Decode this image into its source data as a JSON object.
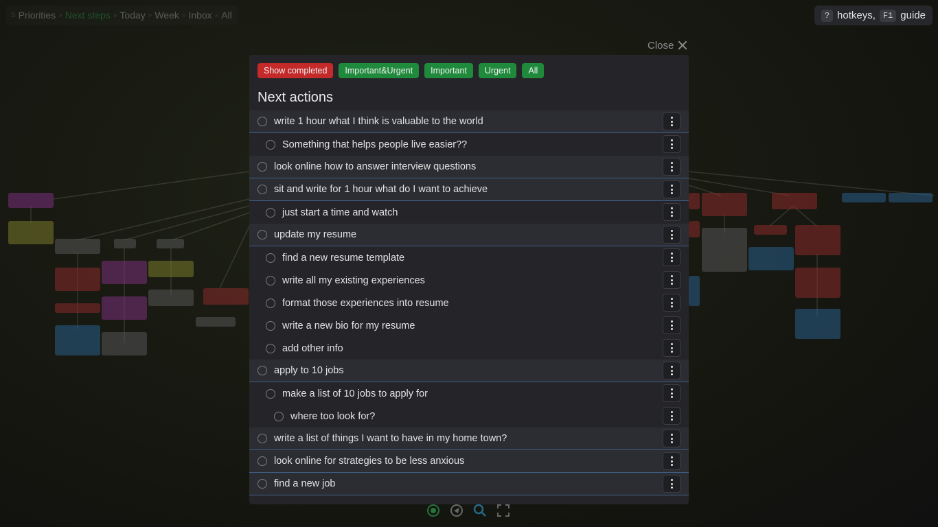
{
  "nav": {
    "items": [
      {
        "label": "Priorities",
        "active": false
      },
      {
        "label": "Next steps",
        "active": true
      },
      {
        "label": "Today",
        "active": false
      },
      {
        "label": "Week",
        "active": false
      },
      {
        "label": "Inbox",
        "active": false
      },
      {
        "label": "All",
        "active": false
      }
    ],
    "separator": "»",
    "leading_glyph": "S"
  },
  "help": {
    "question_key": "?",
    "hotkeys_label": "hotkeys,",
    "f1_key": "F1",
    "guide_label": "guide"
  },
  "close": {
    "label": "Close"
  },
  "filters": [
    {
      "label": "Show completed",
      "color": "#c42a2a"
    },
    {
      "label": "Important&Urgent",
      "color": "#1f8a3c"
    },
    {
      "label": "Important",
      "color": "#1f8a3c"
    },
    {
      "label": "Urgent",
      "color": "#1f8a3c"
    },
    {
      "label": "All",
      "color": "#1f8a3c"
    }
  ],
  "list_title": "Next actions",
  "tasks": [
    {
      "text": "write 1 hour what I think is valuable to the world",
      "level": 0
    },
    {
      "text": "Something that helps people live easier??",
      "level": 1
    },
    {
      "text": "look online how to answer interview questions",
      "level": 0
    },
    {
      "text": "sit and write for 1 hour what do I want to achieve",
      "level": 0
    },
    {
      "text": "just start a time and watch",
      "level": 1
    },
    {
      "text": "update my resume",
      "level": 0
    },
    {
      "text": "find a new resume template",
      "level": 1
    },
    {
      "text": "write all my existing experiences",
      "level": 1
    },
    {
      "text": "format those experiences into resume",
      "level": 1
    },
    {
      "text": "write a new bio for my resume",
      "level": 1
    },
    {
      "text": "add other info",
      "level": 1
    },
    {
      "text": "apply to 10 jobs",
      "level": 0
    },
    {
      "text": "make a list of 10 jobs to apply for",
      "level": 1
    },
    {
      "text": "where too look for?",
      "level": 2
    },
    {
      "text": "write a list of things I want to have in my home town?",
      "level": 0
    },
    {
      "text": "look online for strategies to be less anxious",
      "level": 0
    },
    {
      "text": "find a new job",
      "level": 0
    }
  ],
  "colors": {
    "accent_green": "#33b25a",
    "filter_red": "#c42a2a",
    "filter_green": "#1f8a3c",
    "row_divider": "#3f5f86"
  },
  "icons": {
    "row_menu": "vertical-dots-icon",
    "close": "close-icon",
    "tools": [
      "add-circle-icon",
      "target-icon",
      "search-icon",
      "fullscreen-icon"
    ]
  }
}
